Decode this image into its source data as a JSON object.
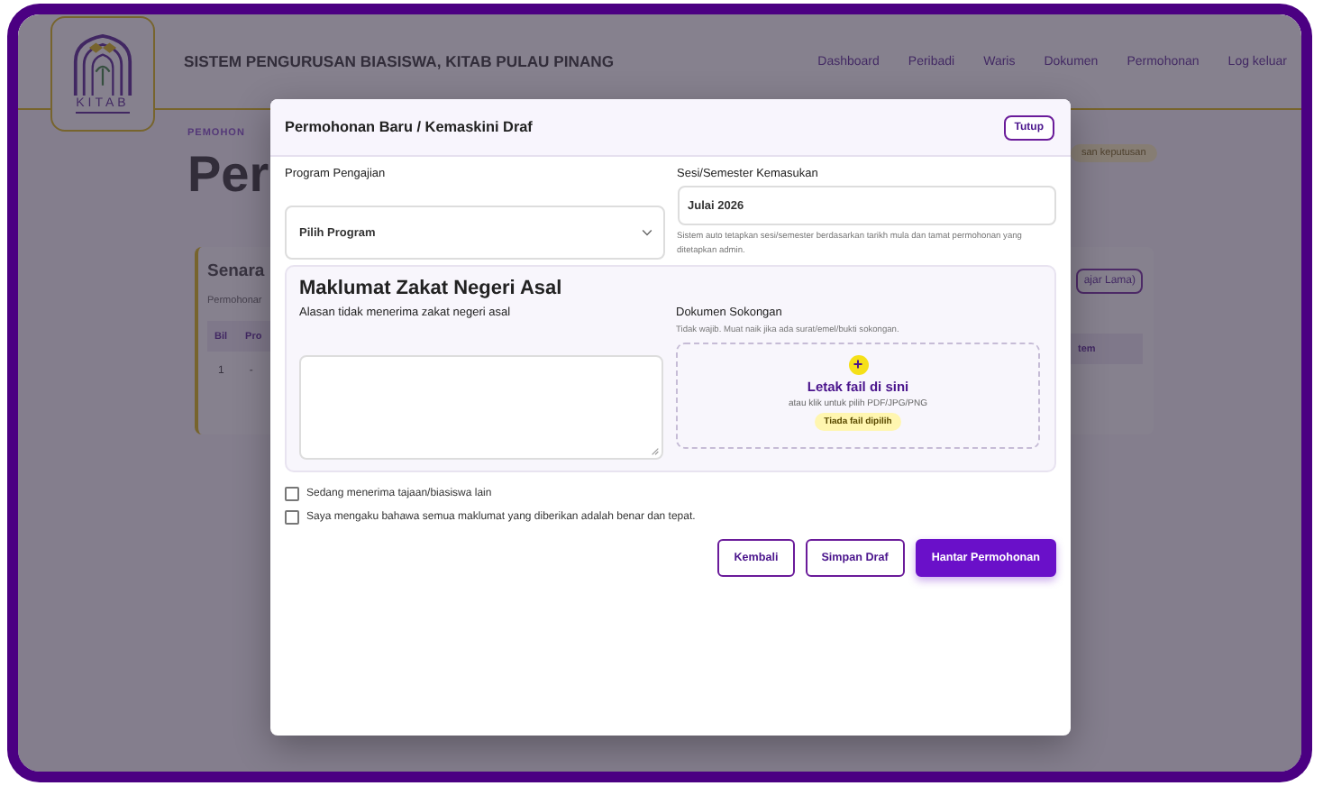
{
  "header": {
    "logo_text": "KITAB",
    "title": "SISTEM PENGURUSAN BIASISWA, KITAB PULAU PINANG",
    "nav": [
      "Dashboard",
      "Peribadi",
      "Waris",
      "Dokumen",
      "Permohonan",
      "Log keluar"
    ]
  },
  "background": {
    "eyebrow": "PEMOHON",
    "heading": "Per",
    "badge": "san keputusan",
    "card": {
      "title": "Senara",
      "subtitle": "Permohonar",
      "button": "ajar Lama)",
      "columns": [
        "Bil",
        "Pro"
      ],
      "right_column": "tem",
      "rows": [
        [
          "1",
          "-"
        ]
      ]
    }
  },
  "modal": {
    "title": "Permohonan Baru / Kemaskini Draf",
    "close_label": "Tutup",
    "program": {
      "label": "Program Pengajian",
      "value": "Pilih Program"
    },
    "session": {
      "label": "Sesi/Semester Kemasukan",
      "value": "Julai 2026",
      "help": "Sistem auto tetapkan sesi/semester berdasarkan tarikh mula dan tamat permohonan yang ditetapkan admin."
    },
    "zakat": {
      "heading": "Maklumat Zakat Negeri Asal",
      "reason_label": "Alasan tidak menerima zakat negeri asal",
      "document": {
        "label": "Dokumen Sokongan",
        "hint": "Tidak wajib. Muat naik jika ada surat/emel/bukti sokongan.",
        "drop_icon": "+",
        "drop_title": "Letak fail di sini",
        "drop_hint": "atau klik untuk pilih PDF/JPG/PNG",
        "file_status": "Tiada fail dipilih"
      }
    },
    "checkboxes": [
      {
        "label": "Sedang menerima tajaan/biasiswa lain",
        "checked": false
      },
      {
        "label": "Saya mengaku bahawa semua maklumat yang diberikan adalah benar dan tepat.",
        "checked": false
      }
    ],
    "buttons": [
      {
        "label": "Kembali",
        "kind": "outline"
      },
      {
        "label": "Simpan Draf",
        "kind": "outline"
      },
      {
        "label": "Hantar Permohonan",
        "kind": "primary"
      }
    ]
  }
}
